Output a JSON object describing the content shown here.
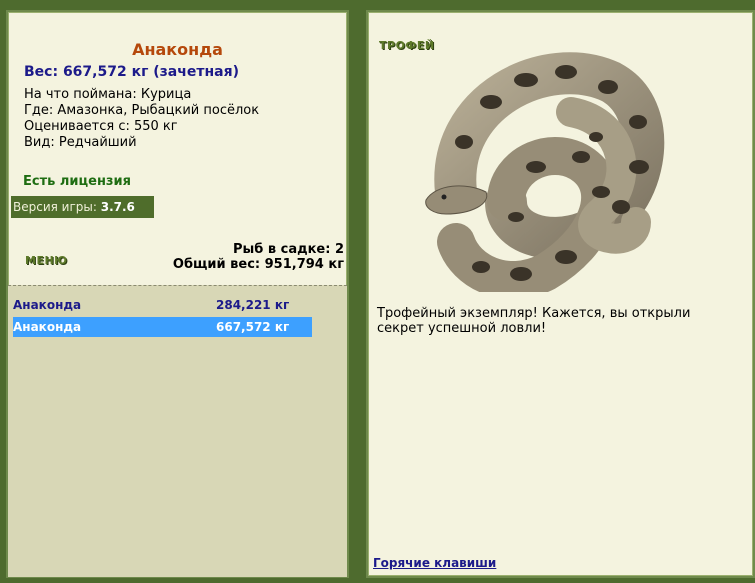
{
  "fish": {
    "name": "Анаконда",
    "weight": "Вес: 667,572 кг (зачетная)",
    "bait": "На что поймана: Курица",
    "location": "Где: Амазонка, Рыбацкий посёлок",
    "price": "Оценивается с: 550 кг",
    "rarity": "Вид: Редчайший"
  },
  "license": "Есть лицензия",
  "version": {
    "label": "Версия игры:",
    "value": "3.7.6"
  },
  "menu_label": "МЕНЮ",
  "stats": {
    "count": "Рыб в садке: 2",
    "total": "Общий вес: 951,794 кг"
  },
  "catch_list": [
    {
      "name": "Анаконда",
      "weight": "284,221 кг",
      "selected": false
    },
    {
      "name": "Анаконда",
      "weight": "667,572 кг",
      "selected": true
    }
  ],
  "trophy": {
    "label": "ТРОФЕЙ",
    "text": "Трофейный экземпляр! Кажется, вы открыли секрет успешной ловли!"
  },
  "hotkeys_label": "Горячие клавиши",
  "colors": {
    "background": "#4e6b2e",
    "panel": "#f4f3df",
    "selected_row": "#3da0ff",
    "fish_name": "#b5480b",
    "link": "#1c1a8a"
  }
}
